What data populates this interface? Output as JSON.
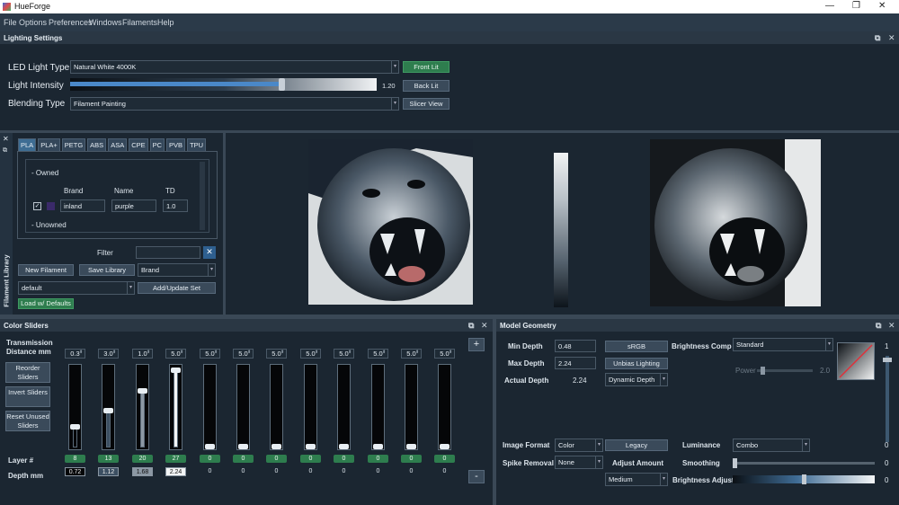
{
  "app": {
    "title": "HueForge"
  },
  "menu": [
    "File",
    "Options",
    "Preferences",
    "Windows",
    "Filaments",
    "Help"
  ],
  "lighting": {
    "title": "Lighting Settings",
    "led_label": "LED Light Type",
    "led_value": "Natural White 4000K",
    "intensity_label": "Light Intensity",
    "intensity_value": "1.20",
    "intensity_fraction": 0.79,
    "blend_label": "Blending Type",
    "blend_value": "Filament Painting",
    "front_lit": "Front Lit",
    "back_lit": "Back Lit",
    "slicer_view": "Slicer View"
  },
  "library": {
    "side_label": "Filament Library",
    "tabs": [
      "PLA",
      "PLA+",
      "PETG",
      "ABS",
      "ASA",
      "CPE",
      "PC",
      "PVB",
      "TPU"
    ],
    "owned": "- Owned",
    "unowned": "- Unowned",
    "col_brand": "Brand",
    "col_name": "Name",
    "col_td": "TD",
    "row": {
      "brand": "inland",
      "name": "purple",
      "td": "1.0",
      "color": "#3a2a6a"
    },
    "filter_label": "Filter",
    "filter_value": "",
    "new_filament": "New Filament",
    "save_library": "Save Library",
    "sort_value": "Brand",
    "set_value": "default",
    "add_update_set": "Add/Update Set",
    "load_defaults": "Load w/ Defaults"
  },
  "color_sliders": {
    "title": "Color Sliders",
    "transmission_label": "Transmission Distance mm",
    "reorder": "Reorder Sliders",
    "invert": "Invert Sliders",
    "reset": "Reset Unused Sliders",
    "layer_label": "Layer #",
    "depth_label": "Depth mm",
    "add": "+",
    "remove": "-",
    "sliders": [
      {
        "td": "0.3",
        "layer": "8",
        "depth": "0.72",
        "color": "#050608",
        "level": 0.25
      },
      {
        "td": "3.0",
        "layer": "13",
        "depth": "1.12",
        "color": "#3c4f62",
        "level": 0.45
      },
      {
        "td": "1.0",
        "layer": "20",
        "depth": "1.68",
        "color": "#8c98a4",
        "level": 0.7
      },
      {
        "td": "5.0",
        "layer": "27",
        "depth": "2.24",
        "color": "#f2f4f5",
        "level": 0.97
      },
      {
        "td": "5.0",
        "layer": "0",
        "depth": "0",
        "color": null,
        "level": 0
      },
      {
        "td": "5.0",
        "layer": "0",
        "depth": "0",
        "color": null,
        "level": 0
      },
      {
        "td": "5.0",
        "layer": "0",
        "depth": "0",
        "color": null,
        "level": 0
      },
      {
        "td": "5.0",
        "layer": "0",
        "depth": "0",
        "color": null,
        "level": 0
      },
      {
        "td": "5.0",
        "layer": "0",
        "depth": "0",
        "color": null,
        "level": 0
      },
      {
        "td": "5.0",
        "layer": "0",
        "depth": "0",
        "color": null,
        "level": 0
      },
      {
        "td": "5.0",
        "layer": "0",
        "depth": "0",
        "color": null,
        "level": 0
      },
      {
        "td": "5.0",
        "layer": "0",
        "depth": "0",
        "color": null,
        "level": 0
      }
    ]
  },
  "geometry": {
    "title": "Model Geometry",
    "min_depth_label": "Min Depth",
    "min_depth": "0.48",
    "max_depth_label": "Max Depth",
    "max_depth": "2.24",
    "actual_depth_label": "Actual Depth",
    "actual_depth": "2.24",
    "srgb": "sRGB",
    "unbias": "Unbias Lighting",
    "dynamic_depth": "Dynamic Depth",
    "brightness_comp_label": "Brightness Comp",
    "brightness_comp": "Standard",
    "power_label": "Power",
    "power_value": "2.0",
    "gradient_max": "1",
    "gradient_min": "0",
    "image_format_label": "Image Format",
    "image_format": "Color",
    "legacy": "Legacy",
    "spike_label": "Spike Removal",
    "spike": "None",
    "adjust_label": "Adjust Amount",
    "adjust": "Medium",
    "luminance_label": "Luminance",
    "luminance": "Combo",
    "smoothing_label": "Smoothing",
    "smoothing": "0",
    "brightness_adjust_label": "Brightness Adjust",
    "brightness_adjust": "0"
  }
}
